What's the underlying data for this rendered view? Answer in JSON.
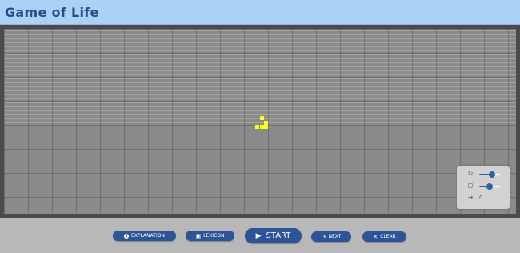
{
  "app": {
    "title": "Game of Life"
  },
  "board": {
    "cell_color": "#ffff14",
    "background_color": "#8a8a8a"
  },
  "controls": {
    "speed_icon": "refresh-icon",
    "speed_level": 0.6,
    "size_icon": "zoom-icon",
    "size_level": 0.5,
    "generation_icon": "arrow-right-icon",
    "generation": "0"
  },
  "toolbar": {
    "explanation_label": "EXPLANATION",
    "explanation_icon": "info-icon",
    "lexicon_label": "LEXICON",
    "lexicon_icon": "book-icon",
    "start_label": "START",
    "start_icon": "play-icon",
    "next_label": "NEXT",
    "next_icon": "step-icon",
    "clear_label": "CLEAR",
    "clear_icon": "close-icon"
  },
  "colors": {
    "accent": "#2d5499",
    "header": "#acd1f7",
    "title": "#2a4d86"
  }
}
